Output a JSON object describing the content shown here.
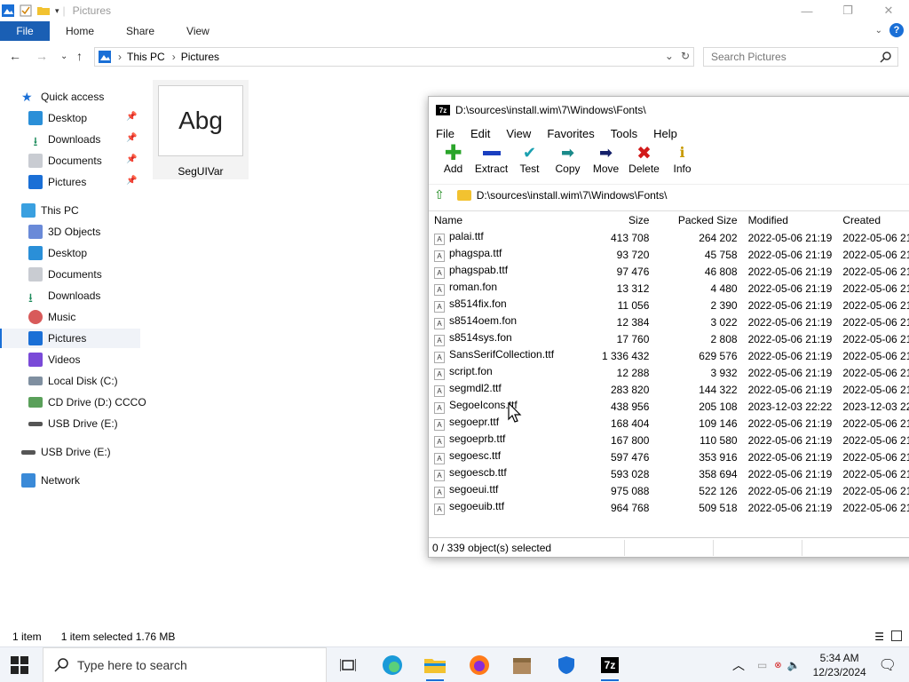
{
  "explorer": {
    "title": "Pictures",
    "ribbon_tabs": [
      "File",
      "Home",
      "Share",
      "View"
    ],
    "help_label": "?",
    "address": {
      "root": "This PC",
      "folder": "Pictures"
    },
    "search_placeholder": "Search Pictures",
    "nav": {
      "quick_access": "Quick access",
      "qa_desktop": "Desktop",
      "qa_downloads": "Downloads",
      "qa_documents": "Documents",
      "qa_pictures": "Pictures",
      "this_pc": "This PC",
      "objects3d": "3D Objects",
      "desktop": "Desktop",
      "documents": "Documents",
      "downloads": "Downloads",
      "music": "Music",
      "pictures": "Pictures",
      "videos": "Videos",
      "local_disk": "Local Disk (C:)",
      "cd_drive": "CD Drive (D:) CCCO",
      "usb_drive_sub": "USB Drive (E:)",
      "usb_drive": "USB Drive (E:)",
      "network": "Network"
    },
    "file": {
      "thumb_text": "Abg",
      "name": "SegUIVar"
    },
    "status": {
      "count": "1 item",
      "selected": "1 item selected  1.76 MB"
    }
  },
  "sevenzip": {
    "title": "D:\\sources\\install.wim\\7\\Windows\\Fonts\\",
    "logo": "7z",
    "menu": {
      "file": "File",
      "edit": "Edit",
      "view": "View",
      "favorites": "Favorites",
      "tools": "Tools",
      "help": "Help"
    },
    "toolbar": {
      "add": "Add",
      "extract": "Extract",
      "test": "Test",
      "copy": "Copy",
      "move": "Move",
      "delete": "Delete",
      "info": "Info"
    },
    "path": "D:\\sources\\install.wim\\7\\Windows\\Fonts\\",
    "columns": {
      "name": "Name",
      "size": "Size",
      "packed": "Packed Size",
      "modified": "Modified",
      "created": "Created"
    },
    "files": [
      {
        "name": "palai.ttf",
        "size": "413 708",
        "packed": "264 202",
        "modified": "2022-05-06 21:19",
        "created": "2022-05-06 21"
      },
      {
        "name": "phagspa.ttf",
        "size": "93 720",
        "packed": "45 758",
        "modified": "2022-05-06 21:19",
        "created": "2022-05-06 21"
      },
      {
        "name": "phagspab.ttf",
        "size": "97 476",
        "packed": "46 808",
        "modified": "2022-05-06 21:19",
        "created": "2022-05-06 21"
      },
      {
        "name": "roman.fon",
        "size": "13 312",
        "packed": "4 480",
        "modified": "2022-05-06 21:19",
        "created": "2022-05-06 21"
      },
      {
        "name": "s8514fix.fon",
        "size": "11 056",
        "packed": "2 390",
        "modified": "2022-05-06 21:19",
        "created": "2022-05-06 21"
      },
      {
        "name": "s8514oem.fon",
        "size": "12 384",
        "packed": "3 022",
        "modified": "2022-05-06 21:19",
        "created": "2022-05-06 21"
      },
      {
        "name": "s8514sys.fon",
        "size": "17 760",
        "packed": "2 808",
        "modified": "2022-05-06 21:19",
        "created": "2022-05-06 21"
      },
      {
        "name": "SansSerifCollection.ttf",
        "size": "1 336 432",
        "packed": "629 576",
        "modified": "2022-05-06 21:19",
        "created": "2022-05-06 21"
      },
      {
        "name": "script.fon",
        "size": "12 288",
        "packed": "3 932",
        "modified": "2022-05-06 21:19",
        "created": "2022-05-06 21"
      },
      {
        "name": "segmdl2.ttf",
        "size": "283 820",
        "packed": "144 322",
        "modified": "2022-05-06 21:19",
        "created": "2022-05-06 21"
      },
      {
        "name": "SegoeIcons.ttf",
        "size": "438 956",
        "packed": "205 108",
        "modified": "2023-12-03 22:22",
        "created": "2023-12-03 22"
      },
      {
        "name": "segoepr.ttf",
        "size": "168 404",
        "packed": "109 146",
        "modified": "2022-05-06 21:19",
        "created": "2022-05-06 21"
      },
      {
        "name": "segoeprb.ttf",
        "size": "167 800",
        "packed": "110 580",
        "modified": "2022-05-06 21:19",
        "created": "2022-05-06 21"
      },
      {
        "name": "segoesc.ttf",
        "size": "597 476",
        "packed": "353 916",
        "modified": "2022-05-06 21:19",
        "created": "2022-05-06 21"
      },
      {
        "name": "segoescb.ttf",
        "size": "593 028",
        "packed": "358 694",
        "modified": "2022-05-06 21:19",
        "created": "2022-05-06 21"
      },
      {
        "name": "segoeui.ttf",
        "size": "975 088",
        "packed": "522 126",
        "modified": "2022-05-06 21:19",
        "created": "2022-05-06 21"
      },
      {
        "name": "segoeuib.ttf",
        "size": "964 768",
        "packed": "509 518",
        "modified": "2022-05-06 21:19",
        "created": "2022-05-06 21"
      }
    ],
    "status": "0 / 339 object(s) selected"
  },
  "taskbar": {
    "search_placeholder": "Type here to search",
    "time": "5:34 AM",
    "date": "12/23/2024"
  },
  "colors": {
    "accent": "#1a5fb4",
    "selection": "#f0f3f8"
  }
}
